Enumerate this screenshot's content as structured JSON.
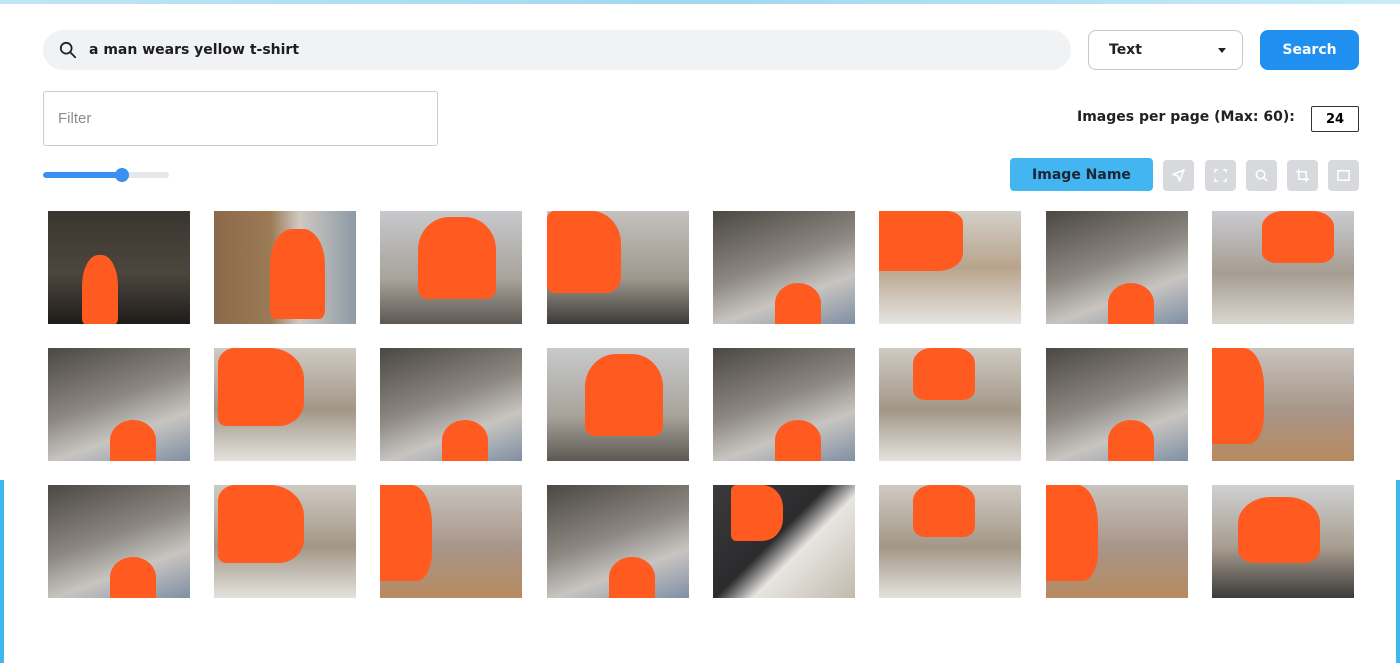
{
  "search": {
    "query": "a man wears yellow t-shirt",
    "type_selected": "Text",
    "search_label": "Search"
  },
  "filter": {
    "placeholder": "Filter"
  },
  "paging": {
    "per_page_label": "Images per page (Max: 60):",
    "per_page_value": "24"
  },
  "slider": {
    "value": 0.62
  },
  "toolbar": {
    "image_name_label": "Image Name",
    "tools": [
      "send-icon",
      "expand-icon",
      "zoom-icon",
      "crop-icon",
      "frame-icon"
    ]
  },
  "colors": {
    "accent": "#1f8ff0",
    "highlight": "#ff5a1f",
    "toggle": "#43b6f2"
  },
  "results": {
    "images": [
      {
        "scene": "hall"
      },
      {
        "scene": "door"
      },
      {
        "scene": "back"
      },
      {
        "scene": "phone"
      },
      {
        "scene": "ceiling"
      },
      {
        "scene": "writing"
      },
      {
        "scene": "ceiling"
      },
      {
        "scene": "desk-right"
      },
      {
        "scene": "ceiling"
      },
      {
        "scene": "writing-left"
      },
      {
        "scene": "ceiling"
      },
      {
        "scene": "back"
      },
      {
        "scene": "ceiling"
      },
      {
        "scene": "writing-right"
      },
      {
        "scene": "ceiling"
      },
      {
        "scene": "side"
      },
      {
        "scene": "ceiling"
      },
      {
        "scene": "writing-left"
      },
      {
        "scene": "side"
      },
      {
        "scene": "ceiling"
      },
      {
        "scene": "sleeve"
      },
      {
        "scene": "writing-right"
      },
      {
        "scene": "side"
      },
      {
        "scene": "phone-right"
      }
    ]
  }
}
